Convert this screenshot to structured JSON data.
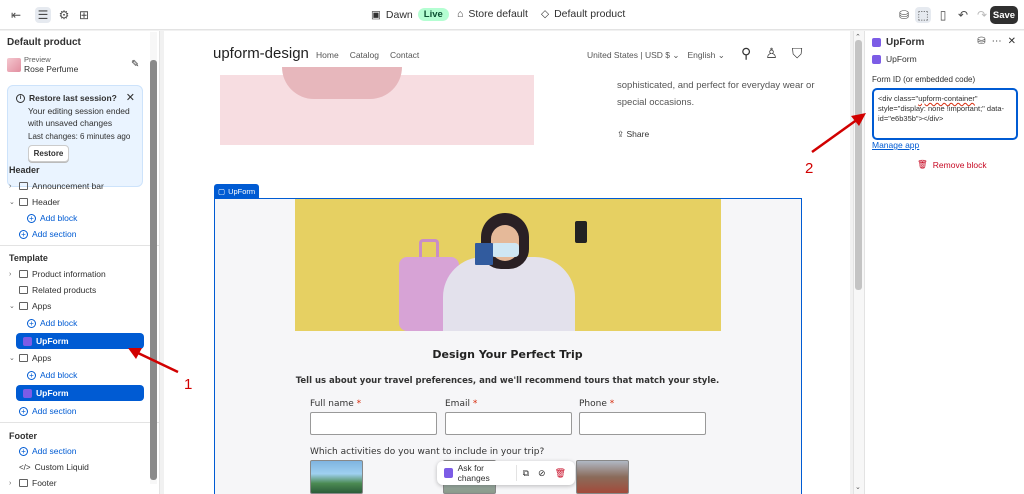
{
  "topbar": {
    "theme_name": "Dawn",
    "live_badge": "Live",
    "store_label": "Store default",
    "template_label": "Default product",
    "save_label": "Save"
  },
  "left_panel": {
    "title": "Default product",
    "preview_label": "Preview",
    "preview_product": "Rose Perfume",
    "banner": {
      "title": "Restore last session?",
      "text": "Your editing session ended with unsaved changes",
      "time": "Last changes: 6 minutes ago",
      "button": "Restore"
    },
    "header_section": {
      "title": "Header",
      "items": [
        "Announcement bar",
        "Header"
      ],
      "add_block": "Add block",
      "add_section": "Add section"
    },
    "template_section": {
      "title": "Template",
      "items": [
        "Product information",
        "Related products",
        "Apps"
      ],
      "add_block": "Add block",
      "selected_app": "UpForm",
      "apps2": "Apps",
      "add_block2": "Add block",
      "selected_app2": "UpForm",
      "add_section": "Add section"
    },
    "footer_section": {
      "title": "Footer",
      "add_section": "Add section",
      "items": [
        "Custom Liquid",
        "Footer"
      ]
    }
  },
  "storefront": {
    "logo": "upform-design",
    "nav": [
      "Home",
      "Catalog",
      "Contact"
    ],
    "locale": "United States | USD $",
    "language": "English",
    "description": "sophisticated, and perfect for everyday wear or special occasions.",
    "share": "Share",
    "upform_tag": "UpForm",
    "form": {
      "title": "Design Your Perfect Trip",
      "subtitle": "Tell us about your travel preferences, and we'll recommend tours that match your style.",
      "fields": [
        {
          "label": "Full name",
          "required": "*"
        },
        {
          "label": "Email",
          "required": "*"
        },
        {
          "label": "Phone",
          "required": "*"
        }
      ],
      "activities_question": "Which activities do you want to include in your trip?"
    },
    "ask_bar": {
      "label": "Ask for changes"
    }
  },
  "right_panel": {
    "title": "UpForm",
    "subtitle": "UpForm",
    "field_label": "Form ID (or embedded code)",
    "code_part1": "<div class=\"",
    "code_part2": "upform-container",
    "code_part3": "\" style=\"display: none !important;\" data-id=\"e6b35b\"></div>",
    "manage_link": "Manage app",
    "remove_label": "Remove block"
  },
  "annotations": {
    "one": "1",
    "two": "2"
  },
  "colors": {
    "accent": "#005bd3",
    "danger": "#d10000",
    "live": "#b4fed2"
  }
}
